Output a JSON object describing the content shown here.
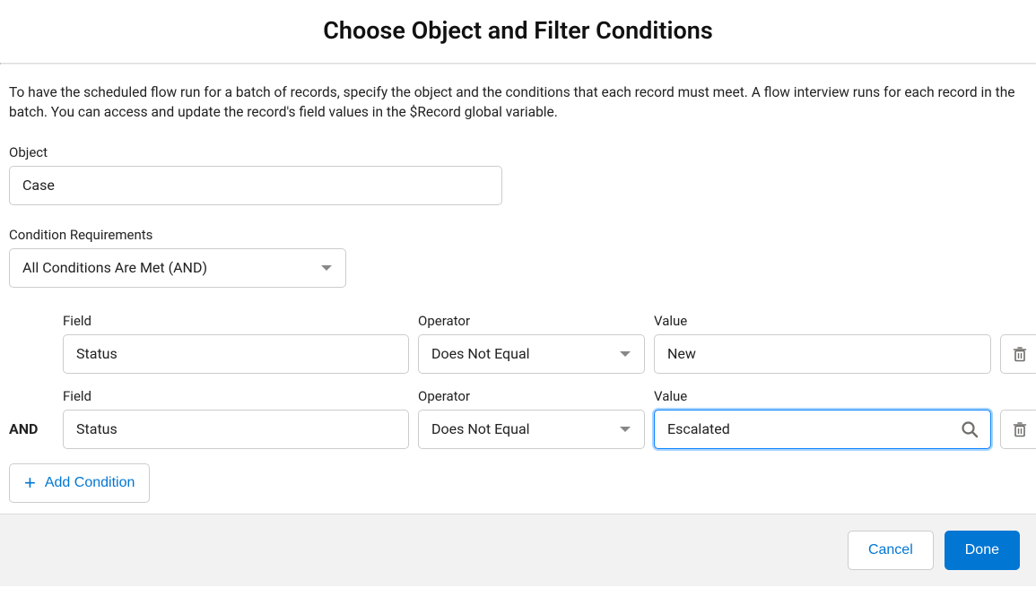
{
  "header": {
    "title": "Choose Object and Filter Conditions"
  },
  "intro": "To have the scheduled flow run for a batch of records, specify the object and the conditions that each record must meet. A flow interview runs for each record in the batch. You can access and update the record's field values in the $Record global variable.",
  "object": {
    "label": "Object",
    "value": "Case"
  },
  "conditionReq": {
    "label": "Condition Requirements",
    "value": "All Conditions Are Met (AND)"
  },
  "columns": {
    "field": "Field",
    "operator": "Operator",
    "value": "Value"
  },
  "andLabel": "AND",
  "rows": [
    {
      "showAnd": false,
      "field": "Status",
      "operator": "Does Not Equal",
      "value": "New",
      "focused": false,
      "showSearch": false
    },
    {
      "showAnd": true,
      "field": "Status",
      "operator": "Does Not Equal",
      "value": "Escalated",
      "focused": true,
      "showSearch": true
    }
  ],
  "addCondition": "Add Condition",
  "footer": {
    "cancel": "Cancel",
    "done": "Done"
  }
}
